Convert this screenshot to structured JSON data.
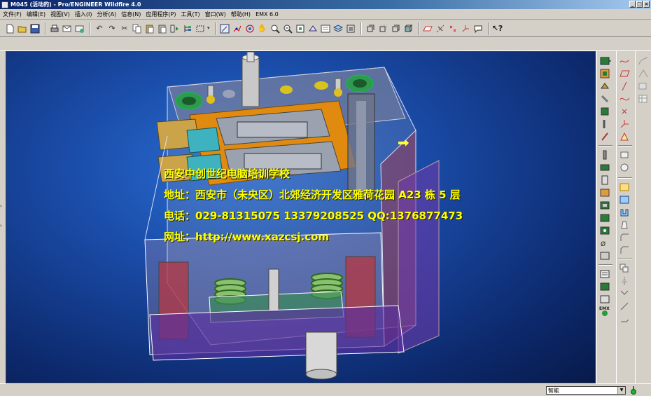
{
  "window": {
    "title": "M045 (活动的) - Pro/ENGINEER Wildfire 4.0"
  },
  "menu": [
    {
      "label": "文件(F)"
    },
    {
      "label": "编辑(E)"
    },
    {
      "label": "视图(V)"
    },
    {
      "label": "插入(I)"
    },
    {
      "label": "分析(A)"
    },
    {
      "label": "信息(N)"
    },
    {
      "label": "应用程序(P)"
    },
    {
      "label": "工具(T)"
    },
    {
      "label": "窗口(W)"
    },
    {
      "label": "帮助(H)"
    },
    {
      "label": "EMX 6.0"
    }
  ],
  "toolbar_icons": [
    "new-icon",
    "open-icon",
    "save-icon",
    "print-icon",
    "email-icon",
    "email-link-icon",
    "undo-icon",
    "redo-icon",
    "cut-icon",
    "copy-icon",
    "paste-icon",
    "paste-special-icon",
    "regenerate-icon",
    "model-tree-icon",
    "selection-box-icon",
    "repaint-icon",
    "spin-center-icon",
    "orient-mode-icon",
    "pan-icon",
    "zoom-in-icon",
    "zoom-out-icon",
    "refit-icon",
    "reorient-icon",
    "saved-views-icon",
    "layers-icon",
    "wireframe-icon",
    "hidden-line-icon",
    "no-hidden-icon",
    "shading-icon",
    "datum-planes-icon",
    "datum-axes-icon",
    "datum-points-icon",
    "coordinate-systems-icon",
    "annotations-icon",
    "context-help-icon"
  ],
  "overlay": {
    "line1": "西安中创世纪电脑培训学校",
    "line2": "地址：西安市（未央区）北郊经济开发区雅荷花园 A23 栋 5 层",
    "line3": "电话：029-81315075   13379208525   QQ:1376877473",
    "line4": "网址：http://www.xazcsj.com"
  },
  "status": {
    "filter_value": "智能"
  },
  "colors": {
    "viewport_bg": "#1a4ca8",
    "overlay_text": "#ffff00",
    "titlebar": "#0a246a"
  }
}
